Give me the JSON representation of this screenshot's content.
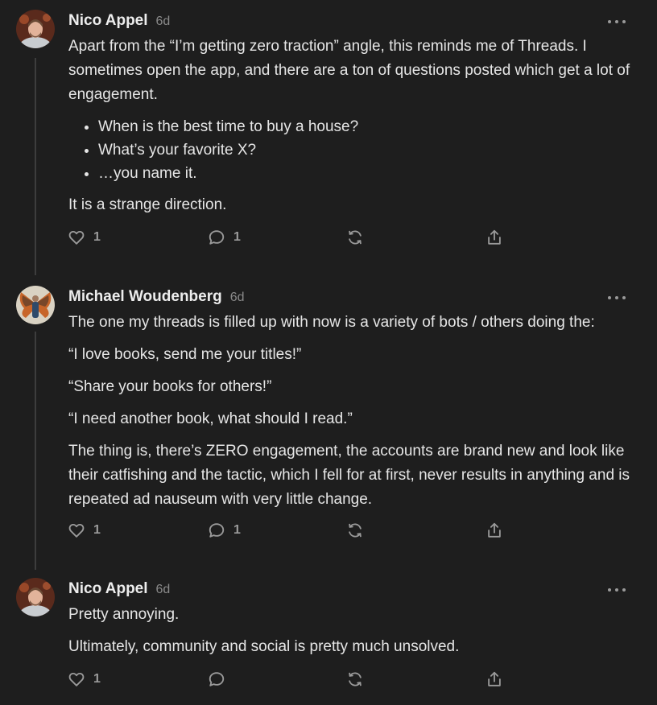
{
  "comments": [
    {
      "author": "Nico Appel",
      "time": "6d",
      "paragraphs_before": [
        "Apart from the “I’m getting zero traction” angle, this reminds me of Threads. I sometimes open the app, and there are a ton of questions posted which get a lot of engagement."
      ],
      "bullets": [
        "When is the best time to buy a house?",
        "What’s your favorite X?",
        "…you name it."
      ],
      "paragraphs_after": [
        "It is a strange direction."
      ],
      "likes": "1",
      "replies": "1"
    },
    {
      "author": "Michael Woudenberg",
      "time": "6d",
      "paragraphs": [
        "The one my threads is filled up with now is a variety of bots / others doing the:",
        "“I love books, send me your titles!”",
        "“Share your books for others!”",
        "“I need another book, what should I read.”",
        "The thing is, there’s ZERO engagement, the accounts are brand new and look like their catfishing and the tactic, which I fell for at first, never results in anything and is repeated ad nauseum with very little change."
      ],
      "likes": "1",
      "replies": "1"
    },
    {
      "author": "Nico Appel",
      "time": "6d",
      "paragraphs": [
        "Pretty annoying.",
        "Ultimately, community and social is pretty much unsolved."
      ],
      "likes": "1",
      "replies": ""
    }
  ],
  "icons": {
    "like": "heart-icon",
    "reply": "comment-bubble-icon",
    "restack": "restack-icon",
    "share": "share-icon",
    "more": "more-horizontal-icon"
  },
  "colors": {
    "background": "#1e1e1e",
    "text": "#e6e6e6",
    "muted": "#9a9a9a",
    "thread_line": "#3d3d3d"
  }
}
